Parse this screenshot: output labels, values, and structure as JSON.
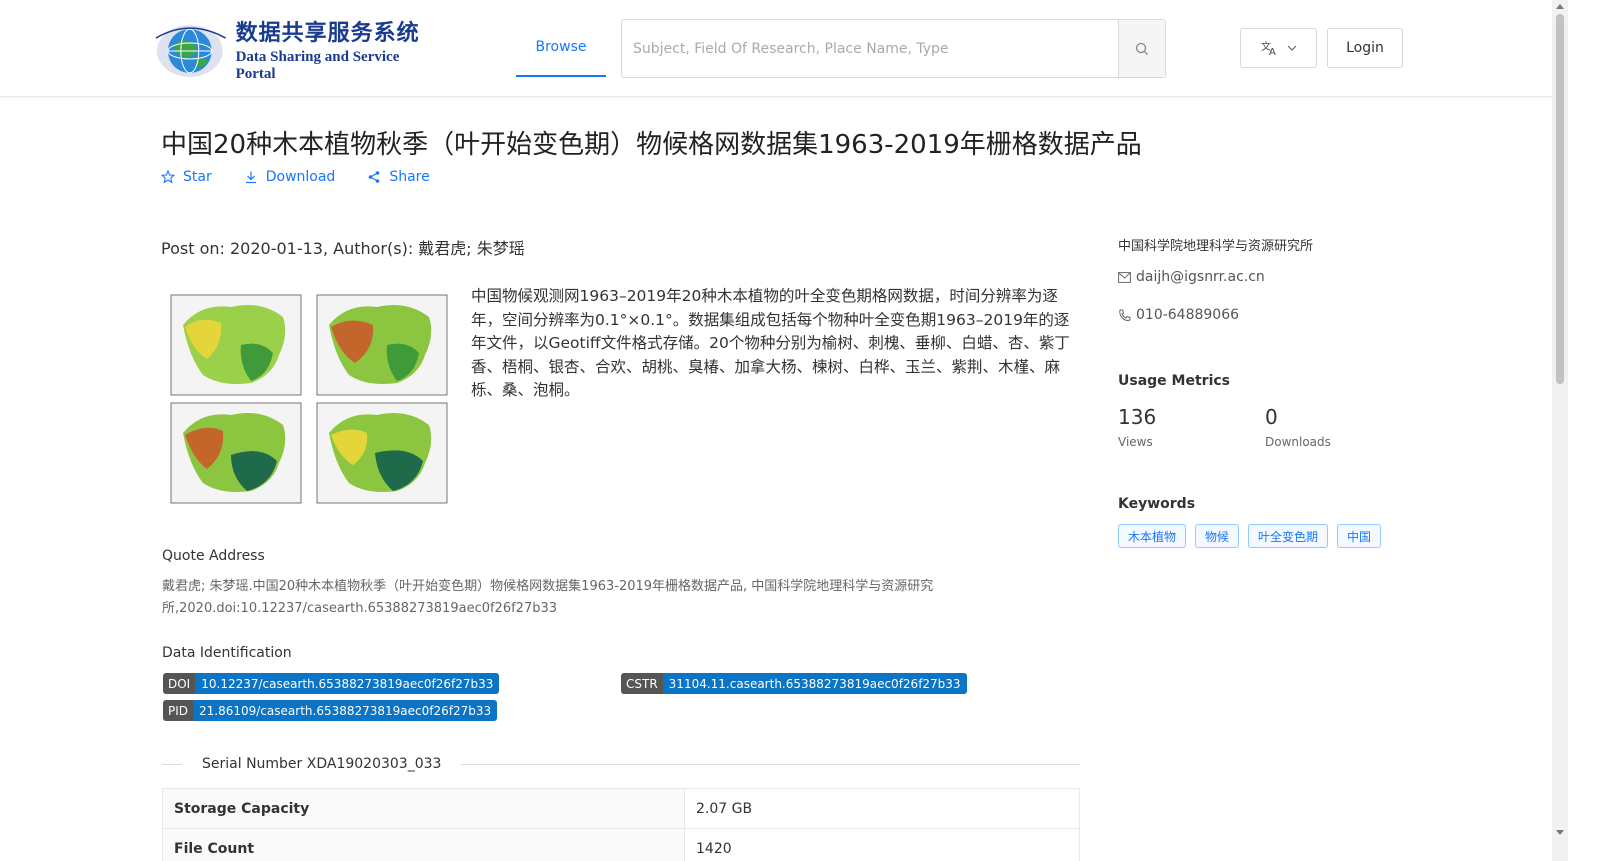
{
  "header": {
    "logo_cn": "数据共享服务系统",
    "logo_en": "Data Sharing and Service Portal",
    "nav_browse": "Browse",
    "search_placeholder": "Subject, Field Of Research, Place Name, Type",
    "login": "Login"
  },
  "dataset": {
    "title": "中国20种木本植物秋季（叶开始变色期）物候格网数据集1963-2019年栅格数据产品",
    "actions": {
      "star": "Star",
      "download": "Download",
      "share": "Share"
    },
    "post_on": "Post on: 2020-01-13, Author(s): 戴君虎; 朱梦瑶",
    "description": "中国物候观测网1963–2019年20种木本植物的叶全变色期格网数据，时间分辨率为逐年，空间分辨率为0.1°×0.1°。数据集组成包括每个物种叶全变色期1963–2019年的逐年文件，以Geotiff文件格式存储。20个物种分别为榆树、刺槐、垂柳、白蜡、杏、紫丁香、梧桐、银杏、合欢、胡桃、臭椿、加拿大杨、楝树、白桦、玉兰、紫荆、木槿、麻栎、桑、泡桐。",
    "quote_title": "Quote Address",
    "quote_text": "戴君虎; 朱梦瑶.中国20种木本植物秋季（叶开始变色期）物候格网数据集1963-2019年栅格数据产品, 中国科学院地理科学与资源研究所,2020.doi:10.12237/casearth.65388273819aec0f26f27b33",
    "ident_title": "Data Identification",
    "identifiers": {
      "doi_key": "DOI",
      "doi_val": "10.12237/casearth.65388273819aec0f26f27b33",
      "cstr_key": "CSTR",
      "cstr_val": "31104.11.casearth.65388273819aec0f26f27b33",
      "pid_key": "PID",
      "pid_val": "21.86109/casearth.65388273819aec0f26f27b33"
    },
    "serial": "Serial Number XDA19020303_033",
    "table": {
      "storage_key": "Storage Capacity",
      "storage_val": "2.07 GB",
      "files_key": "File Count",
      "files_val": "1420"
    }
  },
  "sidebar": {
    "org": "中国科学院地理科学与资源研究所",
    "email": "daijh@igsnrr.ac.cn",
    "phone": "010-64889066",
    "usage_title": "Usage Metrics",
    "views_num": "136",
    "views_label": "Views",
    "downloads_num": "0",
    "downloads_label": "Downloads",
    "keywords_title": "Keywords",
    "keywords": [
      "木本植物",
      "物候",
      "叶全变色期",
      "中国"
    ]
  },
  "colors": {
    "accent": "#1677ff",
    "badge_key": "#555555",
    "badge_val": "#0b74c4"
  }
}
